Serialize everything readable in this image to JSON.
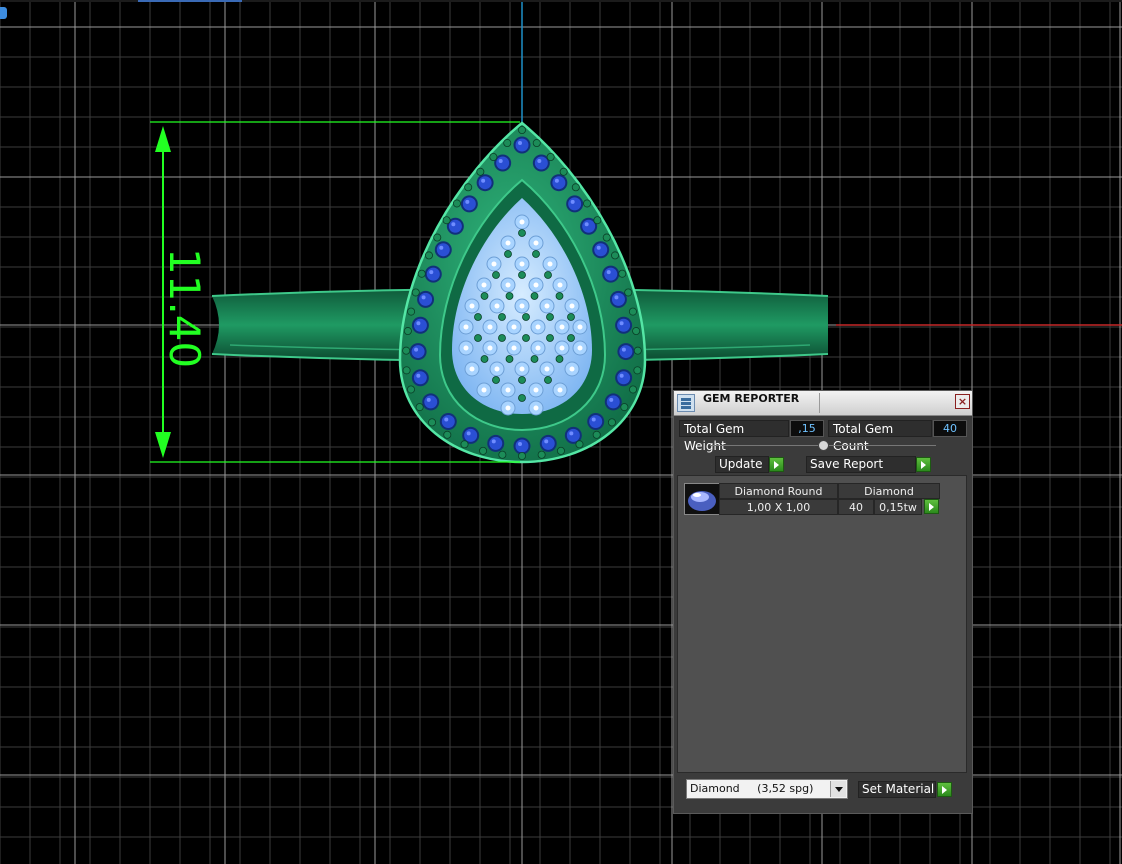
{
  "viewport": {
    "dimension_label": "11.40",
    "colors": {
      "background": "#000000",
      "grid": "#3c3c3c",
      "grid_axis": "#9a9a9a",
      "dimension": "#22ff22",
      "metal": "#1f8f5d",
      "outer_gems": "#2a4fd4",
      "inner_gems": "#a9d4ff",
      "x_axis": "#c62828",
      "y_axis": "#1e90c8"
    }
  },
  "gem_reporter": {
    "title": "GEM REPORTER",
    "close_label": "×",
    "total_weight_label": "Total Gem Weight",
    "total_weight_value": ",15",
    "total_count_label": "Total Gem Count",
    "total_count_value": "40",
    "update_label": "Update",
    "save_report_label": "Save Report",
    "columns": [
      "Diamond Round",
      "Diamond"
    ],
    "rows": [
      {
        "size": "1,00 X 1,00",
        "count": "40",
        "weight": "0,15tw"
      }
    ],
    "material_select": "Diamond     (3,52 spg)",
    "set_material_label": "Set Material"
  }
}
